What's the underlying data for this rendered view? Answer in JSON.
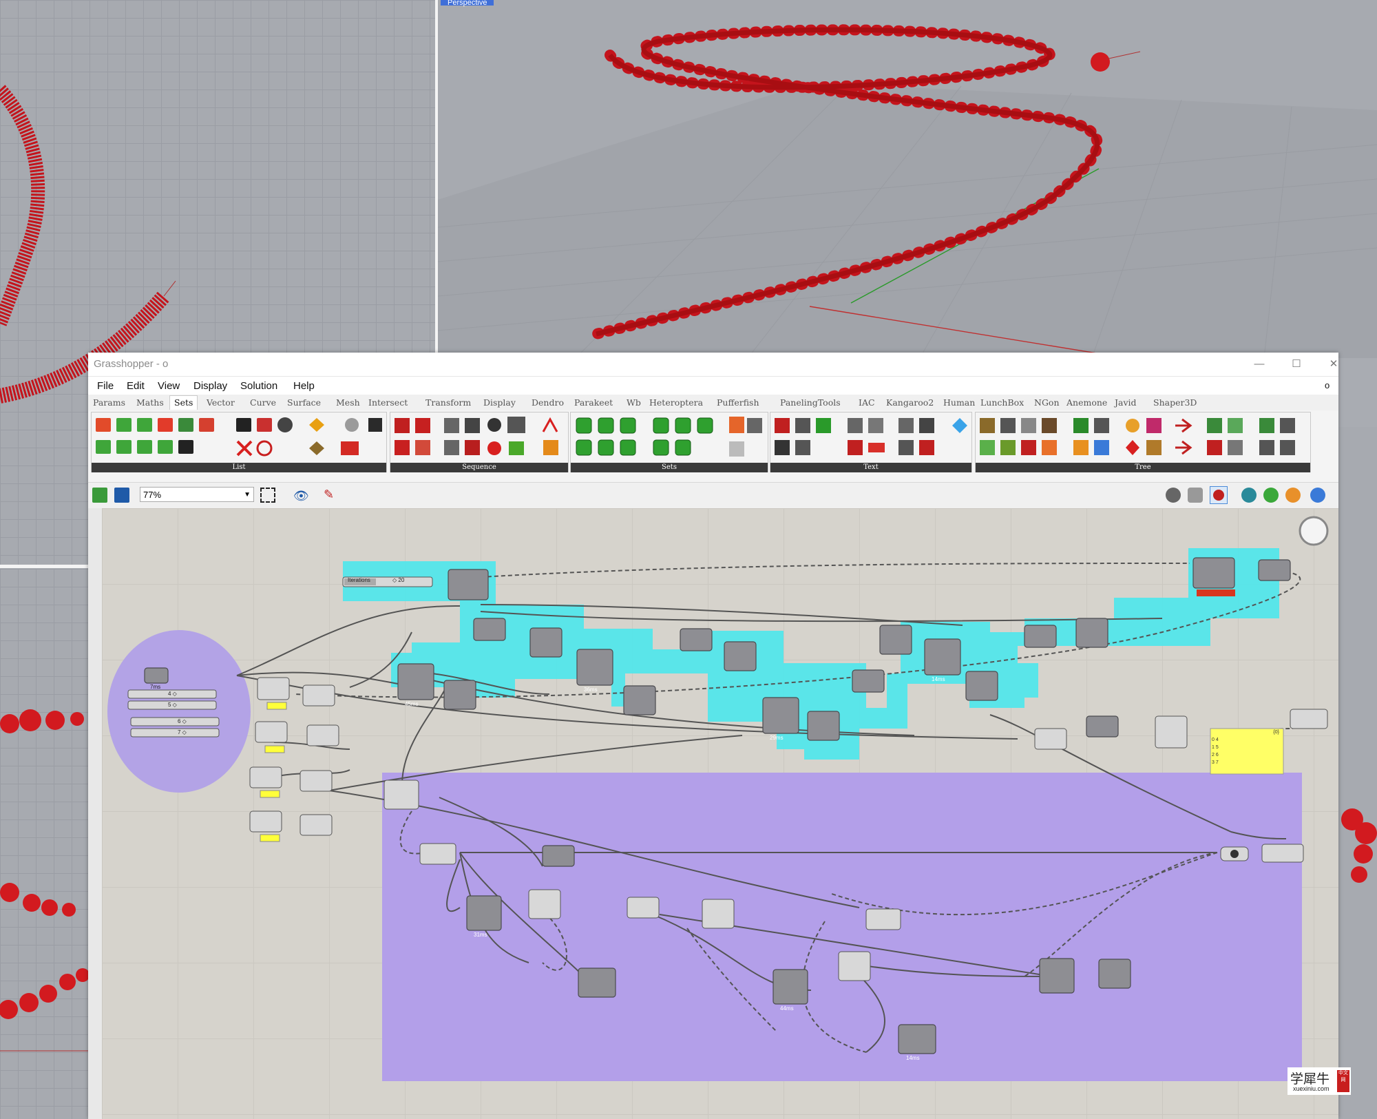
{
  "viewports": {
    "perspective_label": "Perspective"
  },
  "window": {
    "title": "Grasshopper - o",
    "controls": {
      "minimize": "—",
      "maximize": "☐",
      "close": "✕"
    },
    "menu_right": "o"
  },
  "menu": [
    "File",
    "Edit",
    "View",
    "Display",
    "Solution",
    "Help"
  ],
  "tabs": [
    "Params",
    "Maths",
    "Sets",
    "Vector",
    "Curve",
    "Surface",
    "Mesh",
    "Intersect",
    "Transform",
    "Display",
    "Dendro",
    "Parakeet",
    "Wb",
    "Heteroptera",
    "Pufferfish",
    "PanelingTools",
    "IAC",
    "Kangaroo2",
    "Human",
    "LunchBox",
    "NGon",
    "Anemone",
    "Javid",
    "Shaper3D"
  ],
  "active_tab": "Sets",
  "ribbon_panels": [
    "List",
    "Sequence",
    "Sets",
    "Text",
    "Tree"
  ],
  "toolbar": {
    "zoom": "77%"
  },
  "canvas": {
    "slider_label": "Iterations",
    "slider_value": "◇ 20",
    "timers": [
      "7ms",
      "45ms",
      "36ms",
      "29ms",
      "14ms",
      "31ms",
      "44ms",
      "14ms"
    ],
    "small_sliders": [
      "4 ◇",
      "5 ◇",
      "6 ◇",
      "7 ◇"
    ],
    "panel_header": "{0}",
    "panel_lines": [
      "0 4",
      "1 5",
      "2 6",
      "3 7"
    ]
  },
  "watermark": {
    "text": "学犀牛",
    "sub": "xuexiniu.com",
    "badge": "中文网"
  },
  "colors": {
    "group_cyan": "#4de3e8",
    "group_purple": "#b09ee8",
    "curve_red": "#cc1111",
    "panel_yellow": "#ffff66",
    "tab_footer": "#3a3a3a"
  }
}
